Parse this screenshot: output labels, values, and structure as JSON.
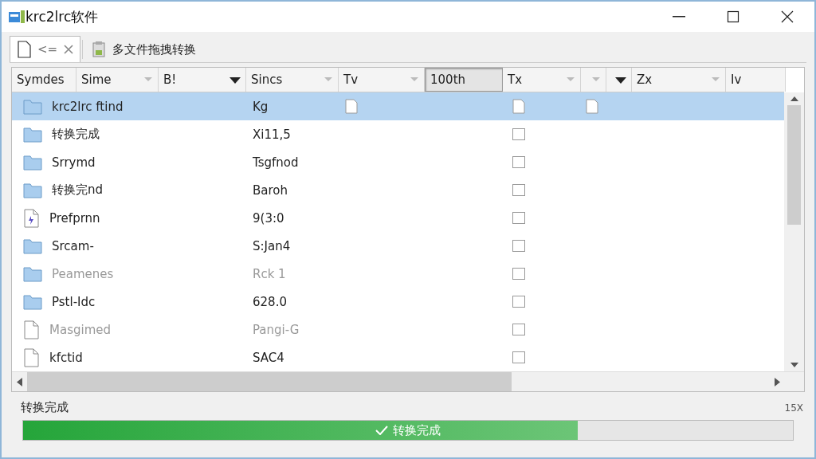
{
  "window": {
    "title": "krc2lrc软件"
  },
  "tabs": [
    {
      "label": "<=",
      "kind": "document",
      "closable": true,
      "selected": true
    },
    {
      "label": "多文件拖拽转换",
      "kind": "clipboard",
      "closable": false,
      "selected": false
    }
  ],
  "table": {
    "columns": [
      {
        "label": "Symdes",
        "kind": "plain",
        "selected": false
      },
      {
        "label": "Sime",
        "kind": "light-dropdown",
        "selected": false
      },
      {
        "label": "B!",
        "kind": "dark-dropdown",
        "selected": false
      },
      {
        "label": "Sincs",
        "kind": "light-dropdown",
        "selected": false
      },
      {
        "label": "Tv",
        "kind": "light-dropdown",
        "selected": false
      },
      {
        "label": "100th",
        "kind": "plain",
        "selected": true
      },
      {
        "label": "Tx",
        "kind": "light-dropdown",
        "selected": false
      },
      {
        "kind": "light-dropdown",
        "selected": false
      },
      {
        "kind": "dark-dropdown",
        "selected": false
      },
      {
        "label": "Zx",
        "kind": "light-dropdown",
        "selected": false
      },
      {
        "label": "Iv",
        "kind": "plain",
        "selected": false
      }
    ],
    "rows": [
      {
        "kind": "folder",
        "name": "krc2lrc ftind",
        "value": "Kg",
        "selected": true,
        "faded": false
      },
      {
        "kind": "folder",
        "name": "转换完成",
        "value": "Xi11,5",
        "checked": false,
        "selected": false,
        "faded": false
      },
      {
        "kind": "folder",
        "name": "Srrymd",
        "value": "Tsgfnod",
        "checked": false,
        "selected": false,
        "faded": false
      },
      {
        "kind": "folder",
        "name": "转换完nd",
        "value": "Baroh",
        "checked": false,
        "selected": false,
        "faded": false
      },
      {
        "kind": "audio",
        "name": "Prefprnn",
        "value": "9(3:0",
        "checked": false,
        "selected": false,
        "faded": false
      },
      {
        "kind": "folder",
        "name": "Srcam-",
        "value": "S:Jan4",
        "checked": false,
        "selected": false,
        "faded": false
      },
      {
        "kind": "folder",
        "name": "Peamenes",
        "value": "Rck 1",
        "checked": false,
        "selected": false,
        "faded": true
      },
      {
        "kind": "folder",
        "name": "Pstl-Idc",
        "value": "628.0",
        "checked": false,
        "selected": false,
        "faded": false
      },
      {
        "kind": "file",
        "name": "Masgimed",
        "value": "Pangi-G",
        "checked": false,
        "selected": false,
        "faded": true
      },
      {
        "kind": "file",
        "name": "kfctid",
        "value": "SAC4",
        "checked": false,
        "selected": false,
        "faded": false
      }
    ]
  },
  "status": {
    "label": "转换完成",
    "zoom": "15X"
  },
  "progress": {
    "level": 0.72,
    "text": "转换完成"
  }
}
